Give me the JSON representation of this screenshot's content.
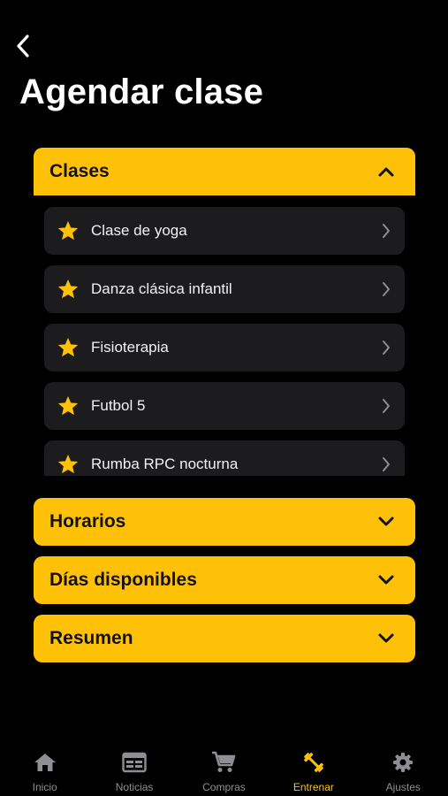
{
  "header": {
    "title": "Agendar clase"
  },
  "sections": {
    "clases": {
      "label": "Clases"
    },
    "horarios": {
      "label": "Horarios"
    },
    "dias": {
      "label": "Días disponibles"
    },
    "resumen": {
      "label": "Resumen"
    }
  },
  "clases_list": [
    {
      "label": "Clase de yoga"
    },
    {
      "label": "Danza clásica infantil"
    },
    {
      "label": "Fisioterapia"
    },
    {
      "label": "Futbol 5"
    },
    {
      "label": "Rumba RPC nocturna"
    }
  ],
  "tabbar": {
    "items": [
      {
        "label": "Inicio",
        "icon": "home-icon"
      },
      {
        "label": "Noticias",
        "icon": "newspaper-icon"
      },
      {
        "label": "Compras",
        "icon": "cart-icon"
      },
      {
        "label": "Entrenar",
        "icon": "dumbbell-icon",
        "active": true
      },
      {
        "label": "Ajustes",
        "icon": "gear-icon"
      }
    ]
  },
  "colors": {
    "accent": "#ffc107",
    "background": "#000000",
    "card": "#1c1c1e",
    "inactive": "#8e8e93"
  }
}
